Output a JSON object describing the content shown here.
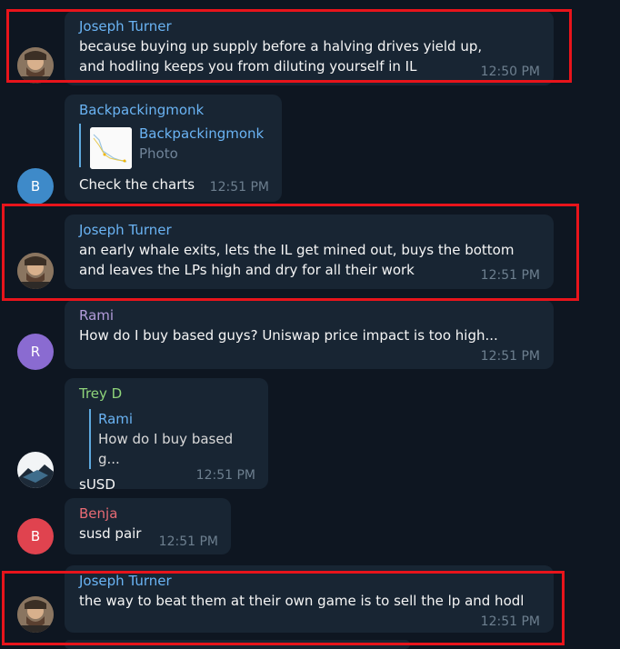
{
  "messages": [
    {
      "sender": "Joseph Turner",
      "text": "because buying up supply before a halving drives yield up, and hodling keeps you from diluting yourself in IL",
      "time": "12:50 PM"
    },
    {
      "sender": "Backpackingmonk",
      "avatar_letter": "B",
      "reply_name": "Backpackingmonk",
      "reply_sub": "Photo",
      "text": "Check the charts",
      "time": "12:51 PM"
    },
    {
      "sender": "Joseph Turner",
      "text": "an early whale exits, lets the IL get mined out, buys the bottom and leaves the LPs high and dry for all their work",
      "time": "12:51 PM"
    },
    {
      "sender": "Rami",
      "avatar_letter": "R",
      "text": "How do I buy based guys? Uniswap price impact is too high...",
      "time": "12:51 PM"
    },
    {
      "sender": "Trey D",
      "reply_name": "Rami",
      "reply_text": "How do I buy based g...",
      "text": "sUSD",
      "time": "12:51 PM"
    },
    {
      "sender": "Benja",
      "avatar_letter": "B",
      "text": "susd pair",
      "time": "12:51 PM"
    },
    {
      "sender": "Joseph Turner",
      "text": "the way to beat them at their own game is to sell the lp and hodl",
      "time": "12:51 PM"
    }
  ],
  "colors": {
    "background": "#0e1621",
    "bubble": "#182533",
    "joseph": "#6ab3f3",
    "backpackingmonk": "#6ab3f3",
    "rami": "#b39ddb",
    "trey": "#8fd47a",
    "benja": "#e86b74",
    "highlight": "#e8141b"
  }
}
